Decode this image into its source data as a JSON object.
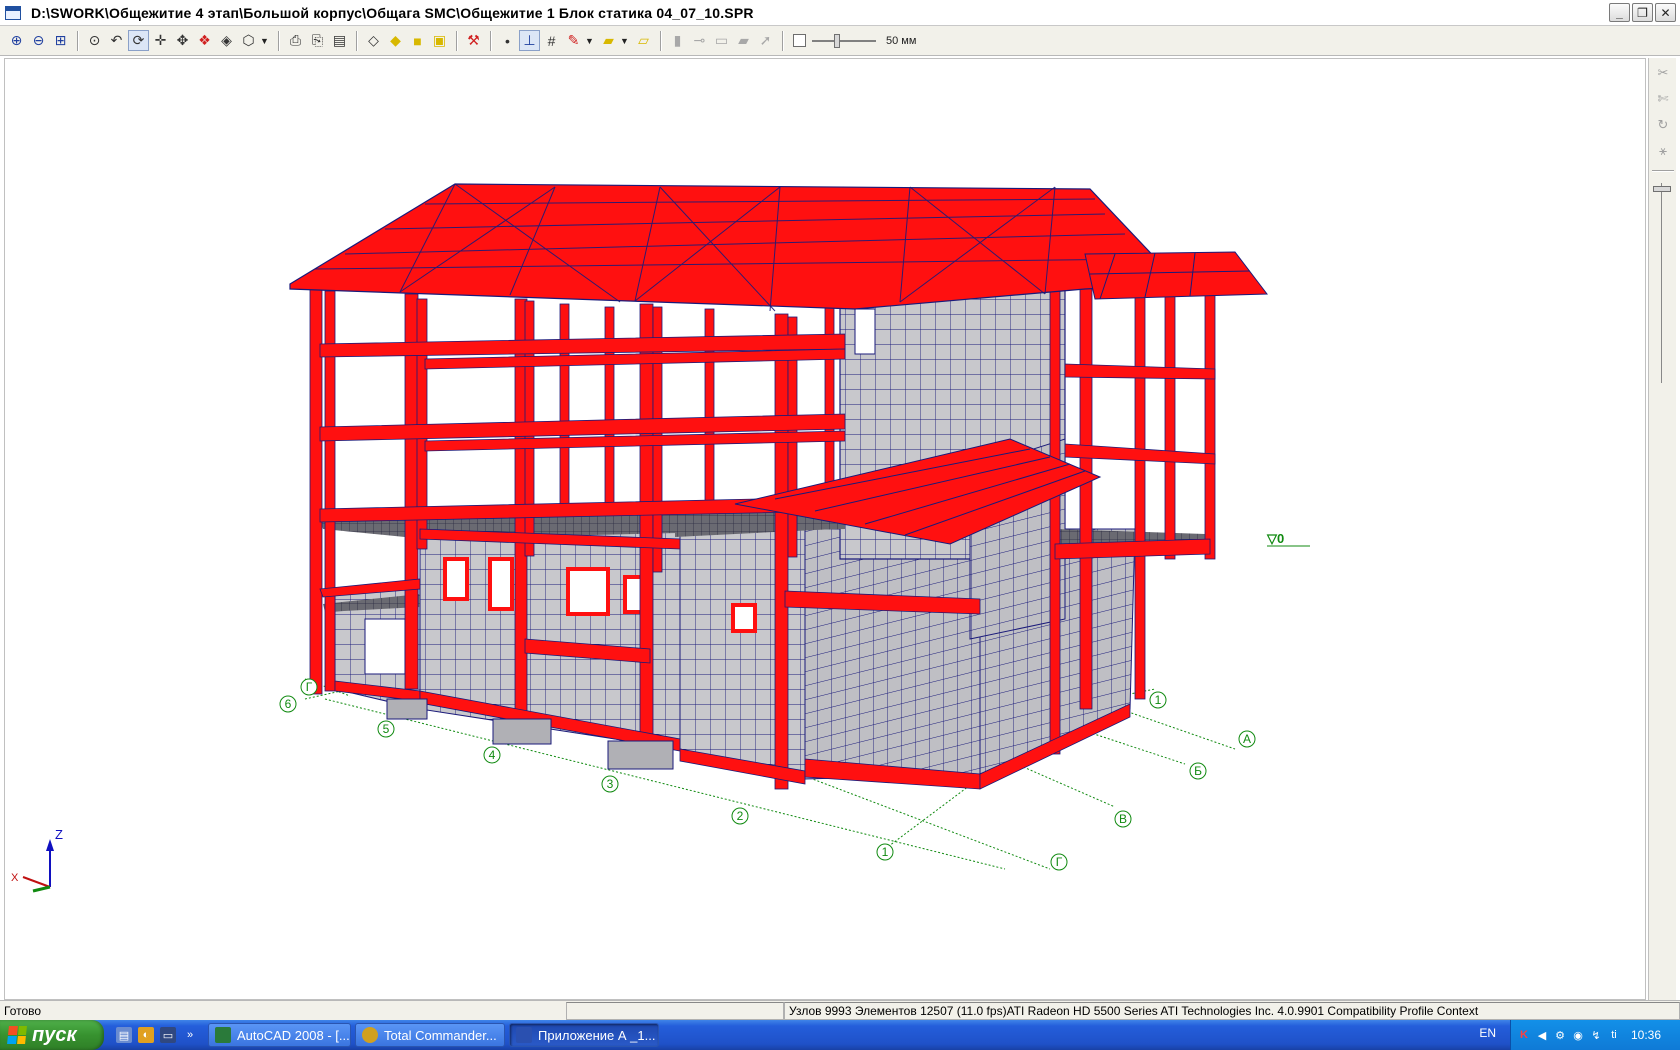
{
  "window": {
    "title": "D:\\SWORK\\Общежитие 4 этап\\Большой корпус\\Общага SMC\\Общежитие 1 Блок статика 04_07_10.SPR"
  },
  "toolbar": {
    "scale_value": "50 мм",
    "buttons": [
      {
        "name": "zoom-in-icon",
        "glyph": "⊕"
      },
      {
        "name": "zoom-out-icon",
        "glyph": "⊖"
      },
      {
        "name": "zoom-window-icon",
        "glyph": "⊞"
      },
      {
        "name": "zoom-all-icon",
        "glyph": "⊙"
      },
      {
        "name": "zoom-previous-icon",
        "glyph": "↶"
      },
      {
        "name": "rotate-icon",
        "glyph": "⟳"
      },
      {
        "name": "pan-icon",
        "glyph": "✛"
      },
      {
        "name": "select-icon",
        "glyph": "✥"
      },
      {
        "name": "filter-icon",
        "glyph": "❖"
      },
      {
        "name": "fragment-icon",
        "glyph": "◈"
      }
    ]
  },
  "viewport": {
    "level_mark": "▽0",
    "axis_z": "Z",
    "axis_x": "X",
    "grid_labels_bottom": [
      "Г",
      "6",
      "5",
      "4",
      "3",
      "2",
      "1",
      "Г"
    ],
    "grid_labels_right": [
      "1",
      "А",
      "Б",
      "В"
    ]
  },
  "statusbar": {
    "ready": "Готово",
    "info": "Узлов 9993  Элементов 12507  (11.0 fps)ATI Radeon HD 5500 Series ATI Technologies Inc. 4.0.9901 Compatibility Profile Context"
  },
  "taskbar": {
    "start_label": "пуск",
    "tasks": [
      {
        "label": "AutoCAD 2008 - [...",
        "icon_color": "#2a7a3a"
      },
      {
        "label": "Total Commander...",
        "icon_color": "#d0a020"
      },
      {
        "label": "Приложение А _1...",
        "icon_color": "#2a50b0"
      }
    ],
    "language": "EN",
    "clock": "10:36"
  },
  "colors": {
    "frame_red": "#ff1010",
    "mesh_blue": "#1a1a7a",
    "wall_grey": "#c8c8cc",
    "grid_green": "#108a10",
    "axis_blue": "#1010c0"
  }
}
